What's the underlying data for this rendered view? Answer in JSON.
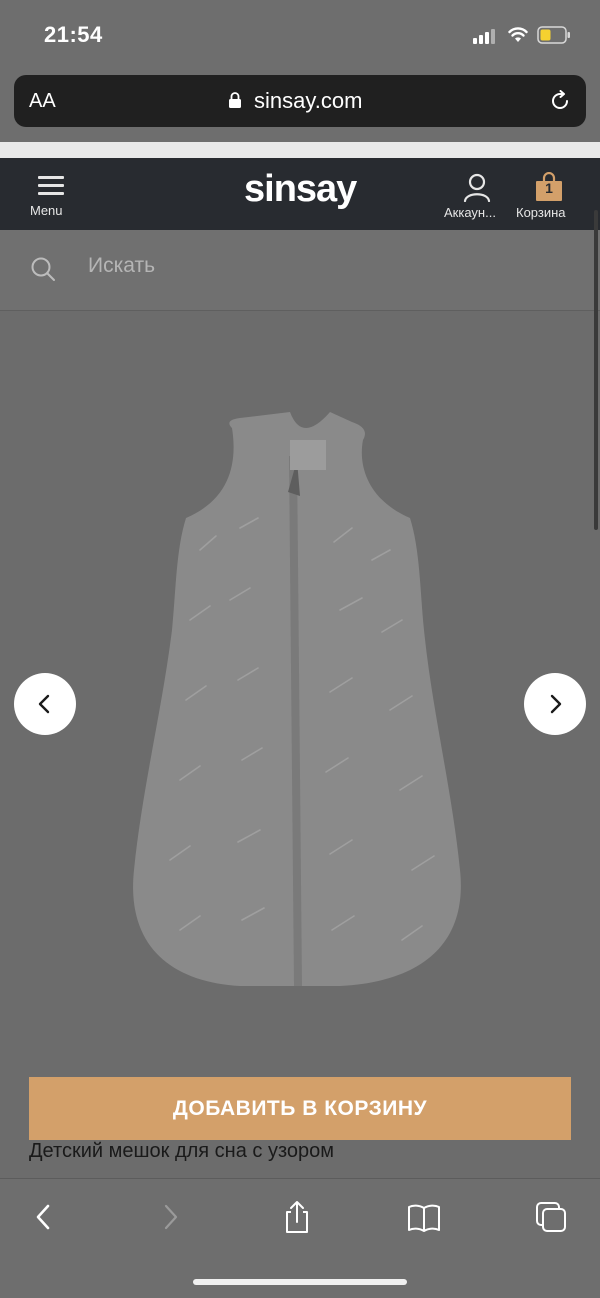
{
  "status_bar": {
    "time": "21:54"
  },
  "browser": {
    "text_size_label": "AA",
    "url": "sinsay.com"
  },
  "header": {
    "menu_label": "Menu",
    "logo": "sinsay",
    "account_label": "Аккаун...",
    "cart_label": "Корзина",
    "cart_count": "1"
  },
  "search": {
    "placeholder": "Искать"
  },
  "product": {
    "image_icon": "sleeping-bag-image",
    "add_to_cart_label": "ДОБАВИТЬ В КОРЗИНУ",
    "title": "Детский мешок для сна с узором"
  },
  "colors": {
    "header_bg": "#282b30",
    "accent": "#d3a06a",
    "overlay": "#6e6e6e"
  }
}
